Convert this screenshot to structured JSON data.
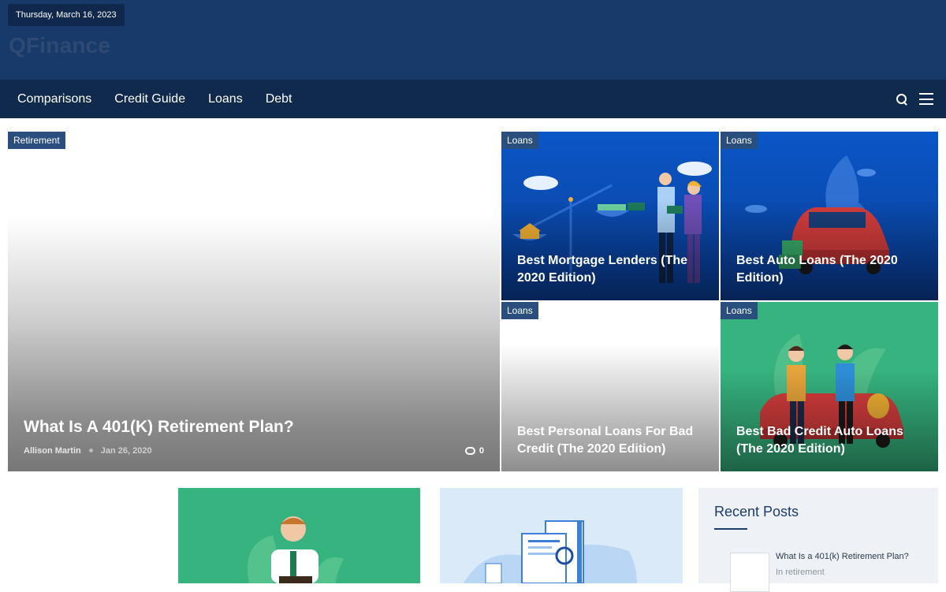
{
  "header": {
    "date": "Thursday, March 16, 2023",
    "site_title": "QFinance"
  },
  "nav": {
    "items": [
      "Comparisons",
      "Credit Guide",
      "Loans",
      "Debt"
    ],
    "icons": [
      "search-icon",
      "menu-icon"
    ]
  },
  "featured": {
    "category": "Retirement",
    "title": "What Is A 401(K) Retirement Plan?",
    "author": "Allison Martin",
    "date": "Jan 26, 2020",
    "comments": "0"
  },
  "cards": [
    {
      "category": "Loans",
      "title": "Best Mortgage Lenders (The 2020 Edition)"
    },
    {
      "category": "Loans",
      "title": "Best Auto Loans (The 2020 Edition)"
    },
    {
      "category": "Loans",
      "title": "Best Personal Loans For Bad Credit (The 2020 Edition)"
    },
    {
      "category": "Loans",
      "title": "Best Bad Credit Auto Loans (The 2020 Edition)"
    }
  ],
  "sidebar": {
    "title": "Recent Posts",
    "recent": [
      {
        "title": "What Is a 401(k) Retirement Plan?",
        "category": "In retirement"
      }
    ]
  },
  "colors": {
    "header_bg": "#173a6a",
    "nav_bg": "#102a4d",
    "badge_bg": "#2a4f7f",
    "green": "#36b37e",
    "blue": "#0a56c6"
  }
}
